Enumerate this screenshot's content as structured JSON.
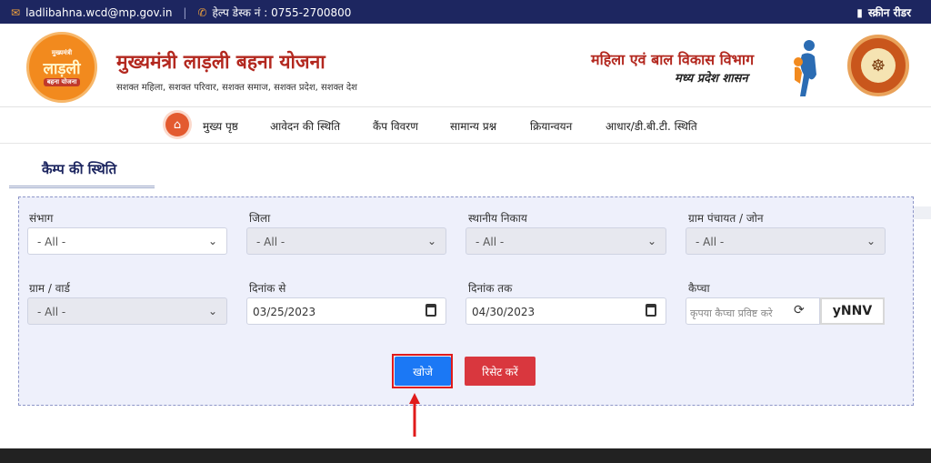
{
  "topbar": {
    "email": "ladlibahna.wcd@mp.gov.in",
    "helpdesk": "हेल्प डेस्क नं : 0755-2700800",
    "screen_reader": "स्क्रीन रीडर"
  },
  "header": {
    "logo_top": "मुख्यमंत्री",
    "logo_main": "लाड़ली",
    "logo_bottom": "बहना योजना",
    "title": "मुख्यमंत्री लाड़ली बहना योजना",
    "subtitle": "सशक्त महिला, सशक्त परिवार, सशक्त समाज, सशक्त प्रदेश, सशक्त देश",
    "dept_line1": "महिला एवं बाल विकास विभाग",
    "dept_line2": "मध्य प्रदेश शासन"
  },
  "nav": {
    "items": [
      "मुख्य पृष्ठ",
      "आवेदन की स्थिति",
      "कैंप विवरण",
      "सामान्य प्रश्न",
      "क्रियान्वयन",
      "आधार/डी.बी.टी. स्थिति"
    ]
  },
  "section": {
    "title": "कैम्प की स्थिति"
  },
  "form": {
    "division": {
      "label": "संभाग",
      "value": "- All -"
    },
    "district": {
      "label": "जिला",
      "value": "- All -"
    },
    "local_body": {
      "label": "स्थानीय निकाय",
      "value": "- All -"
    },
    "gram_panchayat": {
      "label": "ग्राम पंचायत / जोन",
      "value": "- All -"
    },
    "village_ward": {
      "label": "ग्राम / वार्ड",
      "value": "- All -"
    },
    "date_from": {
      "label": "दिनांक से",
      "value": "03/25/2023"
    },
    "date_to": {
      "label": "दिनांक तक",
      "value": "04/30/2023"
    },
    "captcha": {
      "label": "कैप्चा",
      "placeholder": "कृपया कैप्चा प्रविष्ट करे",
      "code": "yNNV"
    },
    "search_label": "खोजे",
    "reset_label": "रिसेट करें"
  },
  "colors": {
    "topbar": "#1d2660",
    "accent_orange": "#f28a1e",
    "title_red": "#b3281f",
    "search_button": "#1b78f5",
    "reset_button": "#d9373e",
    "highlight": "#e01b1b"
  }
}
